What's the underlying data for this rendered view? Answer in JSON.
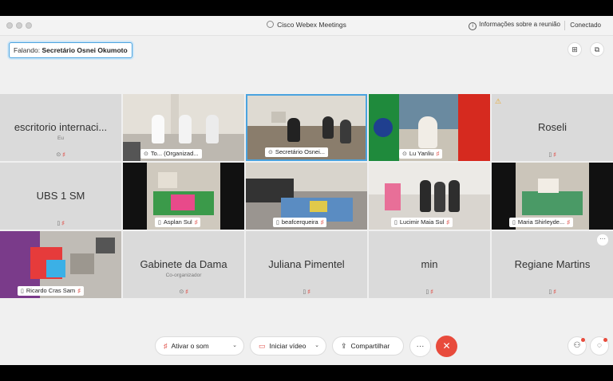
{
  "window": {
    "title": "Cisco Webex Meetings",
    "meeting_info": "Informações sobre a reunião",
    "status": "Conectado"
  },
  "speaker": {
    "prefix": "Falando:",
    "name": "Secretário Osnei Okumoto"
  },
  "participants": [
    {
      "name": "escritorio internaci...",
      "sub": "Eu",
      "mode": "text"
    },
    {
      "name": "To...",
      "role": "(Organizad...",
      "mode": "video"
    },
    {
      "name": "Secretário Osnei...",
      "mode": "video",
      "active": true
    },
    {
      "name": "Lu Yanliu",
      "mode": "video"
    },
    {
      "name": "Roseli",
      "mode": "text",
      "warning": true
    },
    {
      "name": "UBS 1 SM",
      "mode": "text"
    },
    {
      "name": "Asplan Sul",
      "mode": "video"
    },
    {
      "name": "beafcerqueira",
      "mode": "video"
    },
    {
      "name": "Lucimir Maia Sul",
      "mode": "video"
    },
    {
      "name": "Maria Shirleyde...",
      "mode": "video"
    },
    {
      "name": "Ricardo Cras Sam",
      "mode": "video"
    },
    {
      "name": "Gabinete da Dama",
      "sub": "Co-organizador",
      "mode": "text"
    },
    {
      "name": "Juliana Pimentel",
      "mode": "text"
    },
    {
      "name": "min",
      "mode": "text"
    },
    {
      "name": "Regiane Martins",
      "mode": "text"
    }
  ],
  "controls": {
    "audio": "Ativar o som",
    "video": "Iniciar vídeo",
    "share": "Compartilhar",
    "more": "···"
  },
  "colors": {
    "accent": "#4aa3df",
    "end_call": "#e84b3c",
    "muted_mic": "#e0524b"
  }
}
